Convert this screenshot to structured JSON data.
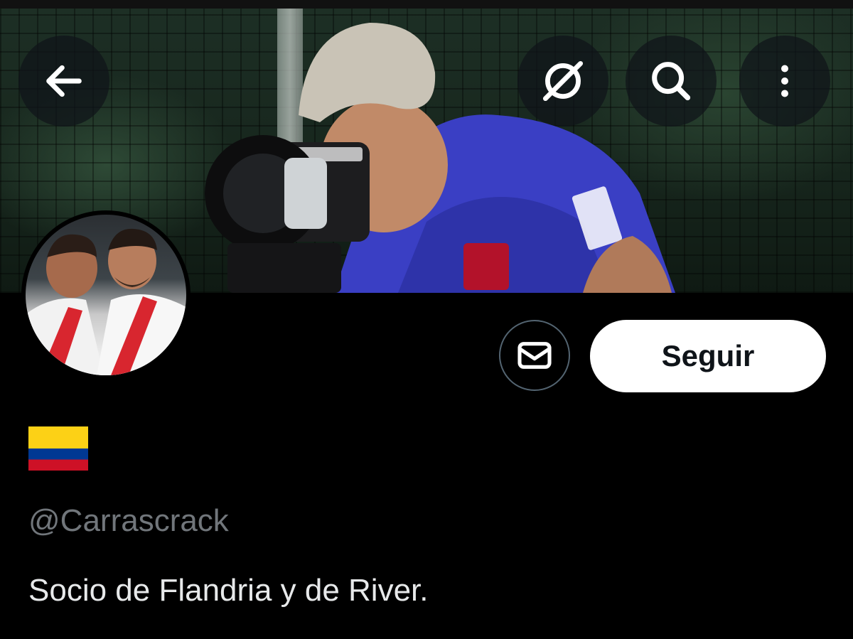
{
  "header": {
    "back_icon": "arrow-left-icon",
    "translate_icon": "translate-off-icon",
    "search_icon": "search-icon",
    "more_icon": "more-vertical-icon"
  },
  "profile": {
    "display_name_emoji": "colombia-flag-icon",
    "handle": "@Carrascrack",
    "bio": "Socio de Flandria y de River.",
    "follow_label": "Seguir",
    "message_icon": "envelope-icon"
  },
  "colors": {
    "background": "#000000",
    "follow_bg": "#ffffff",
    "handle_text": "#71767b",
    "text": "#e7e9ea",
    "flag_yellow": "#fcd116",
    "flag_blue": "#003893",
    "flag_red": "#ce1126"
  }
}
